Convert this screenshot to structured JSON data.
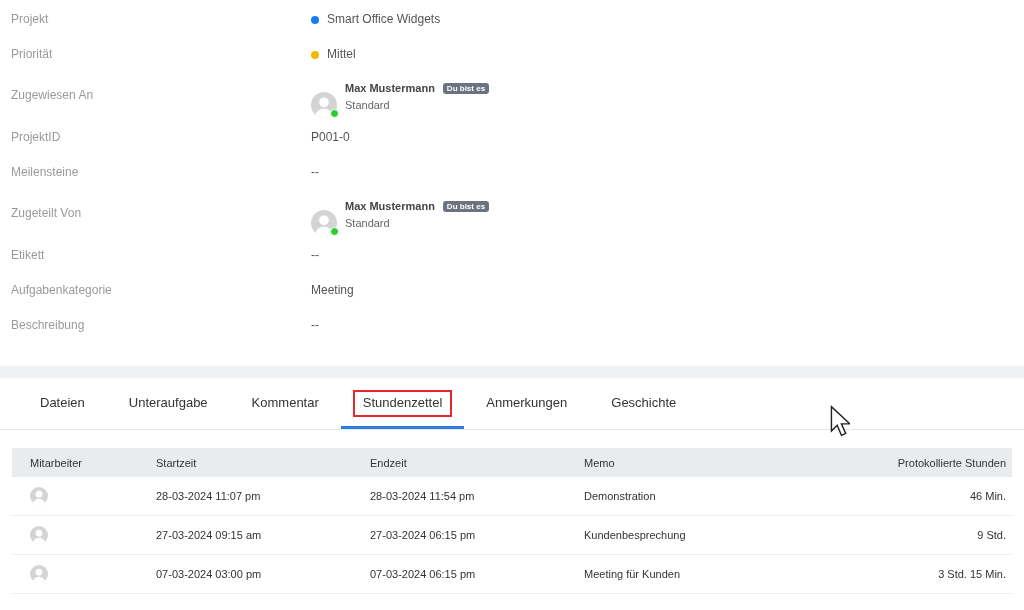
{
  "fields": [
    {
      "label": "Projekt",
      "kind": "dot",
      "value": "Smart Office Widgets",
      "color": "#1a7cf5"
    },
    {
      "label": "Priorität",
      "kind": "dot",
      "value": "Mittel",
      "color": "#f5b800"
    },
    {
      "label": "Zugewiesen An",
      "kind": "user",
      "name": "Max Mustermann",
      "badge": "Du bist es",
      "role": "Standard",
      "online": true
    },
    {
      "label": "ProjektID",
      "kind": "text",
      "value": "P001-0"
    },
    {
      "label": "Meilensteine",
      "kind": "text",
      "value": "--"
    },
    {
      "label": "Zugeteilt Von",
      "kind": "user",
      "name": "Max Mustermann",
      "badge": "Du bist es",
      "role": "Standard",
      "online": true
    },
    {
      "label": "Etikett",
      "kind": "text",
      "value": "--"
    },
    {
      "label": "Aufgabenkategorie",
      "kind": "text",
      "value": "Meeting"
    },
    {
      "label": "Beschreibung",
      "kind": "text",
      "value": "--"
    }
  ],
  "tabs": [
    {
      "label": "Dateien",
      "selected": false
    },
    {
      "label": "Unteraufgabe",
      "selected": false
    },
    {
      "label": "Kommentar",
      "selected": false
    },
    {
      "label": "Stundenzettel",
      "selected": true
    },
    {
      "label": "Anmerkungen",
      "selected": false
    },
    {
      "label": "Geschichte",
      "selected": false
    }
  ],
  "table": {
    "columns": [
      "Mitarbeiter",
      "Startzeit",
      "Endzeit",
      "Memo",
      "Protokollierte Stunden"
    ],
    "rows": [
      {
        "start": "28-03-2024 11:07 pm",
        "end": "28-03-2024 11:54 pm",
        "memo": "Demonstration",
        "hours": "46 Min."
      },
      {
        "start": "27-03-2024 09:15 am",
        "end": "27-03-2024 06:15 pm",
        "memo": "Kundenbesprechung",
        "hours": "9 Std."
      },
      {
        "start": "07-03-2024 03:00 pm",
        "end": "07-03-2024 06:15 pm",
        "memo": "Meeting für Kunden",
        "hours": "3 Std. 15 Min."
      }
    ]
  }
}
